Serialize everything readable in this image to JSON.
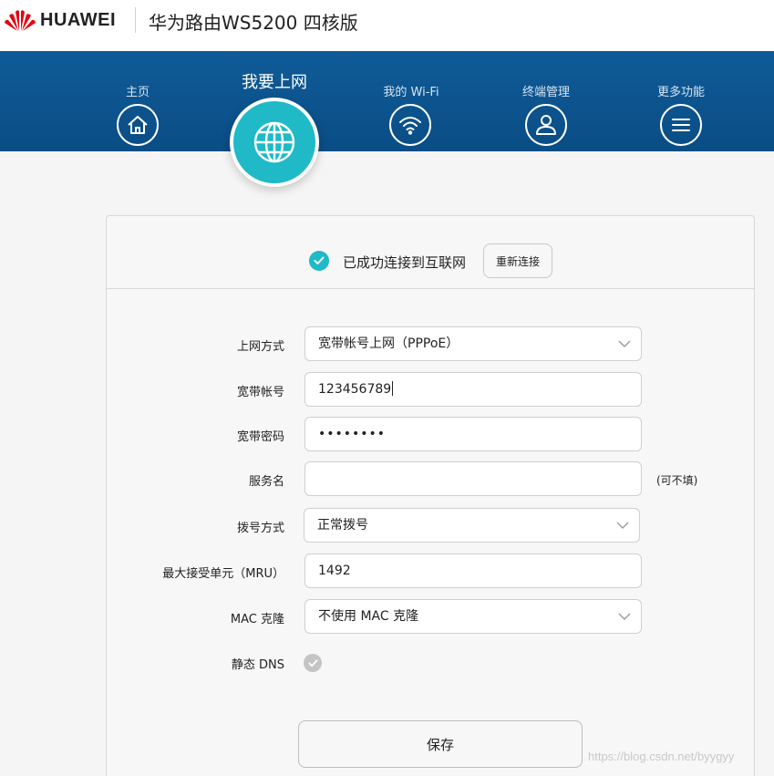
{
  "header": {
    "brand": "HUAWEI",
    "product_title": "华为路由WS5200 四核版"
  },
  "nav": {
    "items": [
      {
        "label": "主页",
        "icon": "home-icon"
      },
      {
        "label": "我要上网",
        "icon": "globe-icon",
        "active": true
      },
      {
        "label": "我的 Wi-Fi",
        "icon": "wifi-icon"
      },
      {
        "label": "终端管理",
        "icon": "user-icon"
      },
      {
        "label": "更多功能",
        "icon": "menu-icon"
      }
    ]
  },
  "status": {
    "text": "已成功连接到互联网",
    "reconnect_label": "重新连接"
  },
  "form": {
    "connection_type_label": "上网方式",
    "connection_type_value": "宽带帐号上网（PPPoE）",
    "account_label": "宽带帐号",
    "account_value": "123456789",
    "password_label": "宽带密码",
    "password_value": "••••••••",
    "service_label": "服务名",
    "service_value": "",
    "service_hint": "(可不填)",
    "dial_label": "拨号方式",
    "dial_value": "正常拨号",
    "mru_label": "最大接受单元（MRU）",
    "mru_value": "1492",
    "mac_label": "MAC 克隆",
    "mac_value": "不使用 MAC 克隆",
    "dns_label": "静态 DNS",
    "dns_enabled": false,
    "save_label": "保存"
  },
  "watermark": "https://blog.csdn.net/byygyy",
  "colors": {
    "nav_bg": "#0a4d85",
    "accent": "#1fb9c7",
    "brand_red": "#e60012"
  }
}
